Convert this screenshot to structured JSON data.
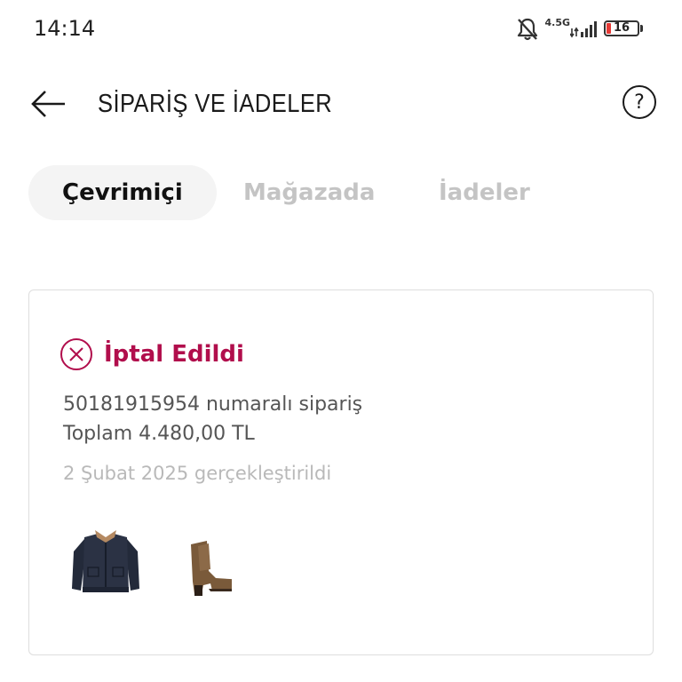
{
  "status_bar": {
    "time": "14:14",
    "network": "4.5G",
    "battery": "16"
  },
  "header": {
    "title": "SİPARİŞ VE İADELER",
    "help_label": "?"
  },
  "tabs": [
    {
      "label": "Çevrimiçi",
      "active": true
    },
    {
      "label": "Mağazada",
      "active": false
    },
    {
      "label": "İadeler",
      "active": false
    }
  ],
  "order": {
    "status": "İptal Edildi",
    "order_line": "50181915954 numaralı sipariş",
    "total_line": "Toplam 4.480,00 TL",
    "date_line": "2 Şubat 2025 gerçekleştirildi",
    "products": [
      {
        "icon": "denim-jacket-image"
      },
      {
        "icon": "brown-ankle-boot-image"
      }
    ]
  },
  "colors": {
    "accent": "#b10e4c",
    "battery_low": "#e53935",
    "tab_active_bg": "#f4f4f4",
    "inactive_text": "#c4c4c4"
  }
}
